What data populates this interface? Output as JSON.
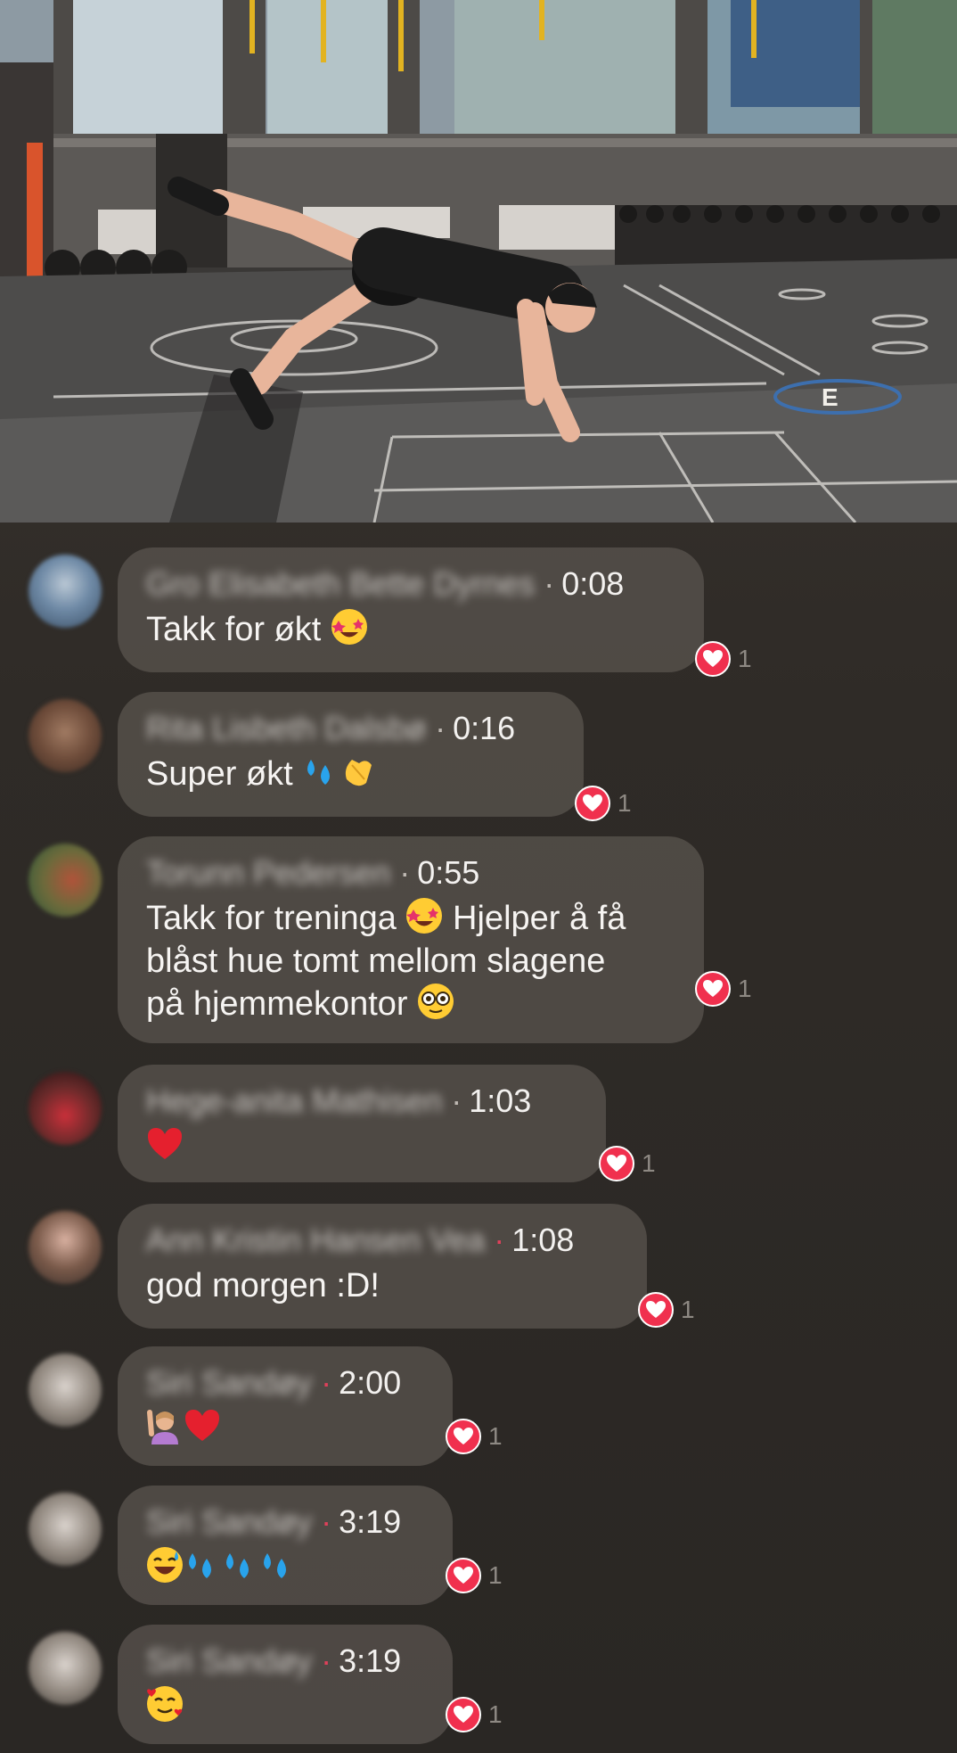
{
  "video": {
    "floor_letter": "E"
  },
  "comments": [
    {
      "author": "Gro Elisabeth Bette Dyrnes",
      "time": "0:08",
      "text": "Takk for økt",
      "emojis": [
        "star-struck"
      ],
      "reaction_count": "1"
    },
    {
      "author": "Rita Lisbeth Dalsbø",
      "time": "0:16",
      "text": "Super økt",
      "emojis": [
        "sweat-droplets",
        "clapping-hands"
      ],
      "reaction_count": "1"
    },
    {
      "author": "Torunn Pedersen",
      "time": "0:55",
      "text_lines": [
        "Takk for treninga",
        "Hjelper å få",
        "blåst hue tomt mellom slagene",
        "på hjemmekontor"
      ],
      "emojis": [
        "star-struck",
        "zany-face"
      ],
      "reaction_count": "1"
    },
    {
      "author": "Hege-anita Mathisen",
      "time": "1:03",
      "text": "",
      "emojis": [
        "red-heart"
      ],
      "reaction_count": "1"
    },
    {
      "author": "Ann Kristin Hansen Vea",
      "time": "1:08",
      "text": "god morgen :D!",
      "emojis": [],
      "reaction_count": "1"
    },
    {
      "author": "Siri Sandøy",
      "time": "2:00",
      "text": "",
      "emojis": [
        "person-raising-hand",
        "red-heart"
      ],
      "reaction_count": "1"
    },
    {
      "author": "Siri Sandøy",
      "time": "3:19",
      "text": "",
      "emojis": [
        "grinning-sweat",
        "sweat-droplets",
        "sweat-droplets",
        "sweat-droplets"
      ],
      "reaction_count": "1"
    },
    {
      "author": "Siri Sandøy",
      "time": "3:19",
      "text": "",
      "emojis": [
        "smiling-face-with-hearts"
      ],
      "reaction_count": "1"
    }
  ],
  "colors": {
    "bubble": "#5c5650",
    "reaction_heart": "#f0304e",
    "background": "#2e2a26"
  }
}
